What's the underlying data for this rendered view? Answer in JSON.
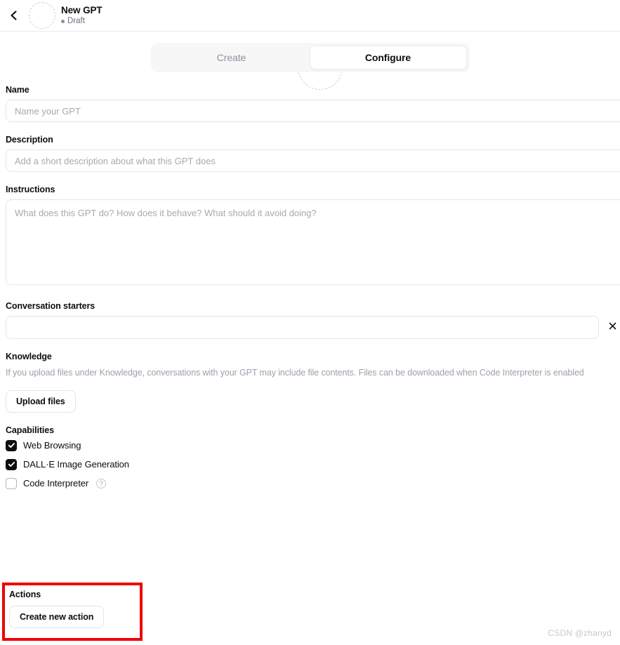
{
  "header": {
    "back_icon": "chevron-left-icon",
    "title": "New GPT",
    "status": "Draft"
  },
  "tabs": [
    {
      "label": "Create",
      "active": false
    },
    {
      "label": "Configure",
      "active": true
    }
  ],
  "form": {
    "name": {
      "label": "Name",
      "placeholder": "Name your GPT",
      "value": ""
    },
    "description": {
      "label": "Description",
      "placeholder": "Add a short description about what this GPT does",
      "value": ""
    },
    "instructions": {
      "label": "Instructions",
      "placeholder": "What does this GPT do? How does it behave? What should it avoid doing?",
      "value": ""
    },
    "conversation_starters": {
      "label": "Conversation starters",
      "items": [
        {
          "value": "",
          "placeholder": "",
          "remove_icon": "close-icon"
        }
      ]
    },
    "knowledge": {
      "label": "Knowledge",
      "help_text": "If you upload files under Knowledge, conversations with your GPT may include file contents. Files can be downloaded when Code Interpreter is enabled",
      "upload_button": "Upload files"
    },
    "capabilities": {
      "label": "Capabilities",
      "items": [
        {
          "label": "Web Browsing",
          "checked": true,
          "help": false
        },
        {
          "label": "DALL·E Image Generation",
          "checked": true,
          "help": false
        },
        {
          "label": "Code Interpreter",
          "checked": false,
          "help": true,
          "help_glyph": "?"
        }
      ]
    },
    "actions": {
      "label": "Actions",
      "create_button": "Create new action",
      "highlight_color": "#ee0000"
    }
  },
  "watermark": "CSDN @zhanyd"
}
